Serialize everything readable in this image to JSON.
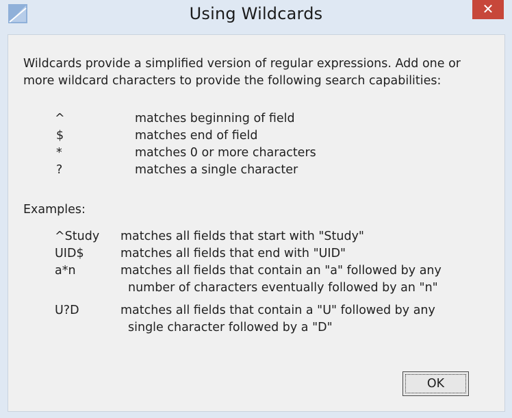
{
  "window": {
    "title": "Using Wildcards",
    "close_glyph": "✕"
  },
  "intro": {
    "line1": "Wildcards provide a simplified version of regular expressions. Add one or",
    "line2": "more wildcard characters to provide the following search capabilities:"
  },
  "wildcards": [
    {
      "symbol": "^",
      "description": "matches beginning of field"
    },
    {
      "symbol": "$",
      "description": "matches end of field"
    },
    {
      "symbol": "*",
      "description": "matches 0 or more characters"
    },
    {
      "symbol": "?",
      "description": "matches a single character"
    }
  ],
  "examples_heading": "Examples:",
  "examples": [
    {
      "pattern": "^Study",
      "desc1": "matches all fields that start with \"Study\"",
      "desc2": ""
    },
    {
      "pattern": "UID$",
      "desc1": "matches all fields that end with \"UID\"",
      "desc2": ""
    },
    {
      "pattern": "a*n",
      "desc1": "matches all fields that contain an \"a\" followed by any",
      "desc2": "number of characters eventually followed by an \"n\""
    },
    {
      "pattern": "U?D",
      "desc1": "matches all fields that contain a \"U\" followed by any",
      "desc2": "single character followed by a \"D\""
    }
  ],
  "ok_label": "OK",
  "colors": {
    "titlebar": "#dfe8f3",
    "close_button": "#c7473a",
    "client_background": "#f0f0f0"
  },
  "icons": {
    "app": "app-logo-icon",
    "close": "close-icon"
  }
}
